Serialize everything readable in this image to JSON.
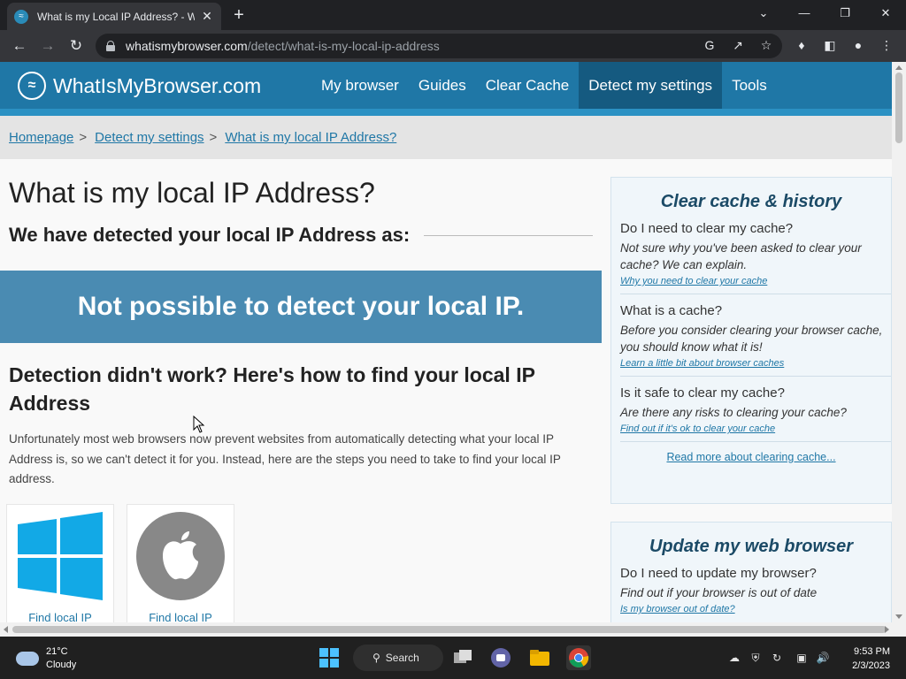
{
  "browser": {
    "tab_title": "What is my Local IP Address? - W",
    "url_host": "whatismybrowser.com",
    "url_path": "/detect/what-is-my-local-ip-address"
  },
  "site": {
    "logo_text": "WhatIsMyBrowser.com",
    "nav": [
      {
        "label": "My browser",
        "active": false
      },
      {
        "label": "Guides",
        "active": false
      },
      {
        "label": "Clear Cache",
        "active": false
      },
      {
        "label": "Detect my settings",
        "active": true
      },
      {
        "label": "Tools",
        "active": false
      }
    ],
    "breadcrumb": [
      "Homepage",
      "Detect my settings",
      "What is my local IP Address?"
    ],
    "breadcrumb_sep": ">"
  },
  "main": {
    "title": "What is my local IP Address?",
    "detected_heading": "We have detected your local IP Address as:",
    "result": "Not possible to detect your local IP.",
    "help_heading": "Detection didn't work? Here's how to find your local IP Address",
    "help_text": "Unfortunately most web browsers now prevent websites from automatically detecting what your local IP Address is, so we can't detect it for you. Instead, here are the steps you need to take to find your local IP address.",
    "cards": [
      {
        "label": "Find local IP",
        "icon": "windows-logo"
      },
      {
        "label": "Find local IP",
        "icon": "apple-logo"
      }
    ]
  },
  "sidebar": {
    "box1": {
      "title": "Clear cache & history",
      "items": [
        {
          "q": "Do I need to clear my cache?",
          "a": "Not sure why you've been asked to clear your cache? We can explain.",
          "link": "Why you need to clear your cache"
        },
        {
          "q": "What is a cache?",
          "a": "Before you consider clearing your browser cache, you should know what it is!",
          "link": "Learn a little bit about browser caches"
        },
        {
          "q": "Is it safe to clear my cache?",
          "a": "Are there any risks to clearing your cache?",
          "link": "Find out if it's ok to clear your cache"
        }
      ],
      "more": "Read more about clearing cache..."
    },
    "box2": {
      "title": "Update my web browser",
      "items": [
        {
          "q": "Do I need to update my browser?",
          "a": "Find out if your browser is out of date",
          "link": "Is my browser out of date?"
        }
      ]
    }
  },
  "taskbar": {
    "temp": "21°C",
    "condition": "Cloudy",
    "search_label": "Search",
    "time": "9:53 PM",
    "date": "2/3/2023"
  }
}
